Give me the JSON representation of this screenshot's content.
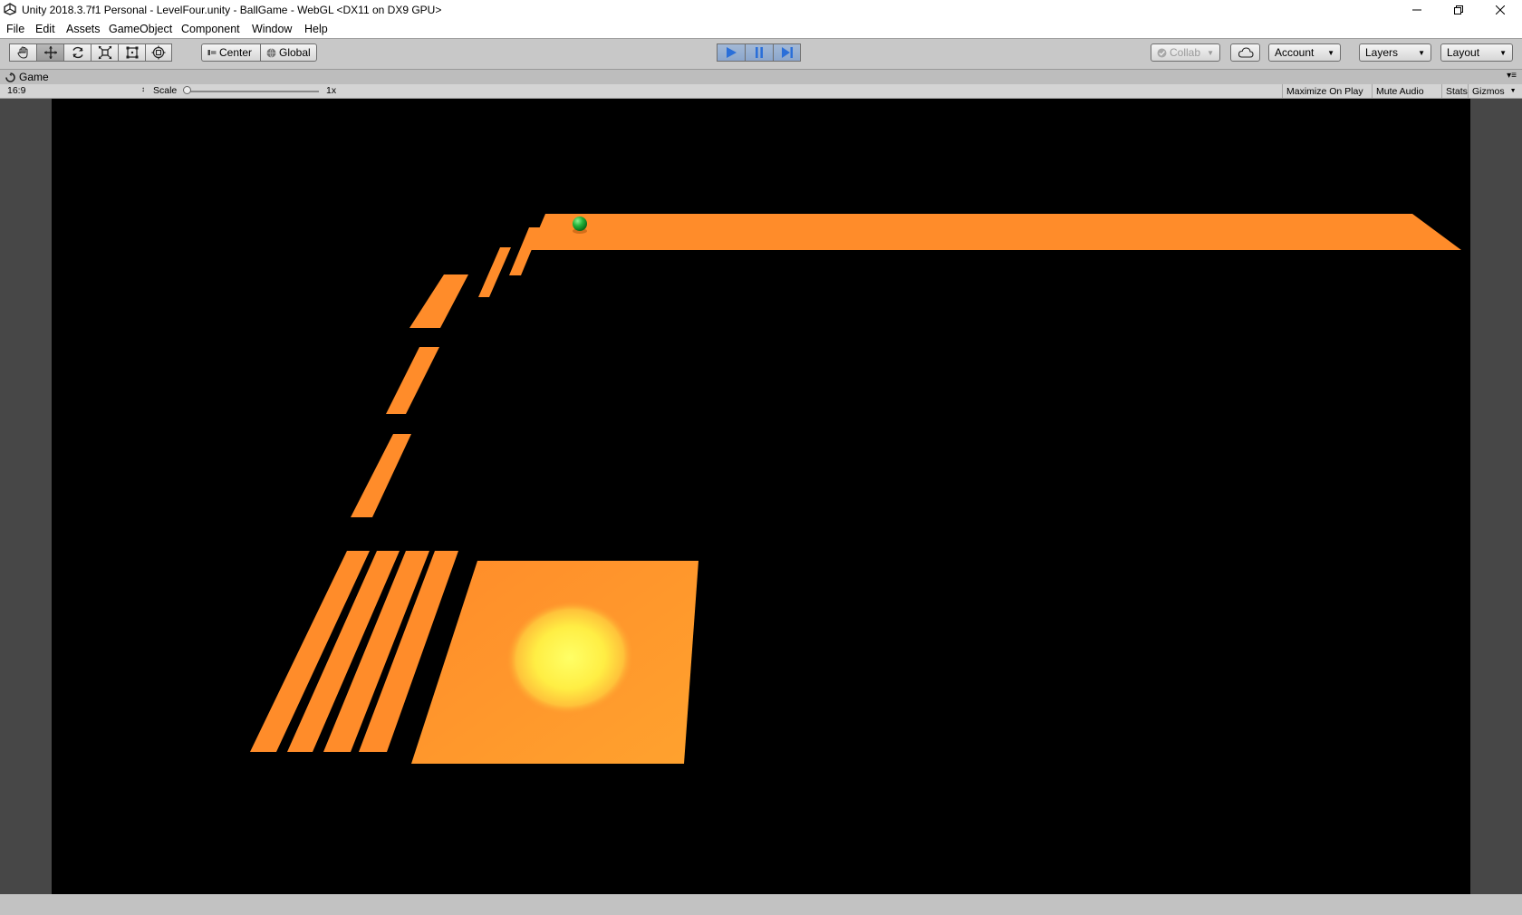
{
  "titlebar": {
    "title": "Unity 2018.3.7f1 Personal - LevelFour.unity - BallGame - WebGL <DX11 on DX9 GPU>",
    "app_icon": "unity-logo-icon",
    "controls": [
      "minimize-icon",
      "restore-icon",
      "close-icon"
    ]
  },
  "menu": {
    "items": [
      "File",
      "Edit",
      "Assets",
      "GameObject",
      "Component",
      "Window",
      "Help"
    ]
  },
  "toolbar": {
    "transform_tools": [
      "hand-tool-icon",
      "move-tool-icon",
      "rotate-tool-icon",
      "scale-tool-icon",
      "rect-tool-icon",
      "transform-tool-icon"
    ],
    "active_tool": "move",
    "pivot_label": "Center",
    "space_label": "Global",
    "playback": [
      "play-icon",
      "pause-icon",
      "step-icon"
    ],
    "play_active": true,
    "collab_label": "Collab",
    "account_label": "Account",
    "layers_label": "Layers",
    "layout_label": "Layout",
    "accent_color": "#2a6fd9"
  },
  "game_view": {
    "tab_label": "Game",
    "aspect": "16:9",
    "scale_label": "Scale",
    "scale_value": "1x",
    "buttons": [
      "Maximize On Play",
      "Mute Audio",
      "Stats",
      "Gizmos"
    ]
  },
  "scene": {
    "background": "#000000",
    "platform_color": "#ff8c2a",
    "light_color": "#ffff66",
    "ball_color": "#22b43a"
  }
}
